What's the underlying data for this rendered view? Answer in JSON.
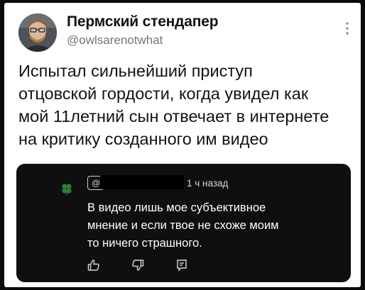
{
  "tweet": {
    "author": {
      "display_name": "Пермский стендапер",
      "handle": "@owlsarenotwhat",
      "avatar_icon": "avatar-photo"
    },
    "more_icon": "more-vertical-icon",
    "text_lines": [
      "Испытал сильнейший приступ",
      "отцовской гордости, когда увидел как",
      "мой 11летний сын отвечает в интернете",
      "на критику созданного им видео"
    ]
  },
  "embedded_comment": {
    "author_handle_prefix": "@",
    "time": "1 ч назад",
    "body_lines": [
      "В видео лишь мое субъективное",
      "мнение и если твое не схоже моим",
      "то ничего страшного."
    ],
    "icons": {
      "commenter": "clover-avatar-icon",
      "like": "thumbs-up-icon",
      "dislike": "thumbs-down-icon",
      "reply": "reply-icon"
    },
    "colors": {
      "background": "#0f0f0f",
      "text": "#ffffff",
      "muted": "#d5d5d5",
      "commenter_icon": "#2e7d32"
    }
  },
  "colors": {
    "page_background": "#ffffff",
    "outer_background": "#0b0b0b",
    "primary_text": "#0f1419",
    "secondary_text": "#6e767d"
  }
}
